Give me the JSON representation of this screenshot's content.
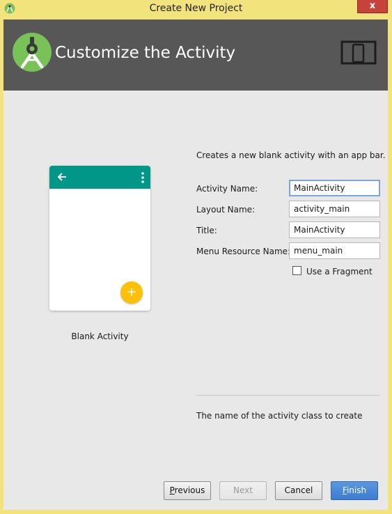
{
  "window": {
    "title": "Create New Project",
    "close_glyph": "x",
    "app_icon": "android-studio-icon"
  },
  "header": {
    "title": "Customize the Activity",
    "logo": "android-studio-logo",
    "device_icon": "phone-tablet-icon"
  },
  "preview": {
    "template_name": "Blank Activity",
    "appbar_color": "#009688",
    "fab_color": "#ffc107",
    "fab_glyph": "+"
  },
  "form": {
    "description": "Creates a new blank activity with an app bar.",
    "fields": [
      {
        "label": "Activity Name:",
        "value": "MainActivity"
      },
      {
        "label": "Layout Name:",
        "value": "activity_main"
      },
      {
        "label": "Title:",
        "value": "MainActivity"
      },
      {
        "label": "Menu Resource Name:",
        "value": "menu_main"
      }
    ],
    "fragment_checkbox": {
      "label": "Use a Fragment",
      "checked": false
    }
  },
  "help_text": "The name of the activity class to create",
  "buttons": {
    "previous": {
      "mnemonic": "P",
      "rest": "revious"
    },
    "next": "Next",
    "cancel": "Cancel",
    "finish": {
      "mnemonic": "F",
      "rest": "inish"
    }
  }
}
